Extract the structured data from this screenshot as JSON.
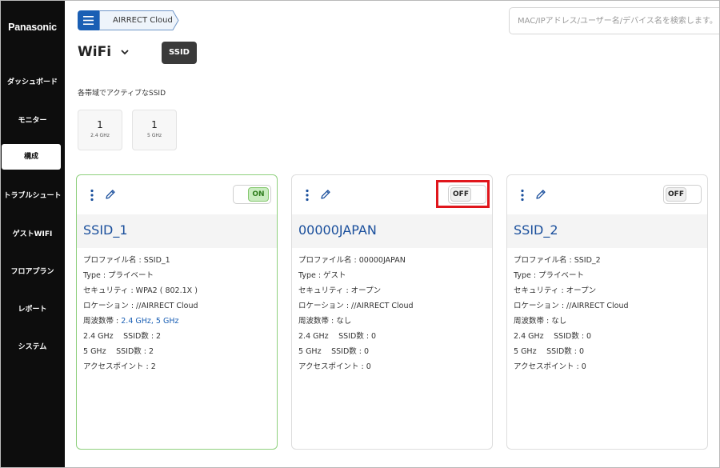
{
  "sidebar": {
    "brand": "Panasonic",
    "items": [
      {
        "label": "ダッシュボード"
      },
      {
        "label": "モニター"
      },
      {
        "label": "構成"
      },
      {
        "label": "トラブルシュート"
      },
      {
        "label": "ゲストWIFI"
      },
      {
        "label": "フロアプラン"
      },
      {
        "label": "レポート"
      },
      {
        "label": "システム"
      }
    ],
    "active_item": "構成"
  },
  "header": {
    "breadcrumb": "AIRRECT Cloud",
    "search_placeholder": "MAC/IPアドレス/ユーザー名/デバイス名を検索します。",
    "page_title": "WiFi",
    "badge": "SSID"
  },
  "bands": {
    "caption": "各帯域でアクティブなSSID",
    "items": [
      {
        "count": "1",
        "label": "2.4 GHz"
      },
      {
        "count": "1",
        "label": "5 GHz"
      }
    ]
  },
  "cards": [
    {
      "toggle": "ON",
      "name": "SSID_1",
      "profile": "プロファイル名 : SSID_1",
      "type": "Type : プライベート",
      "security": "セキュリティ : WPA2 ( 802.1X )",
      "location": "ロケーション : //AIRRECT Cloud",
      "freq_label": "周波数帯 : ",
      "freq_value": "2.4 GHz, 5 GHz",
      "ssid_24": "2.4 GHz　 SSID数 : 2",
      "ssid_5": "5 GHz　 SSID数 : 2",
      "ap": "アクセスポイント : 2"
    },
    {
      "toggle": "OFF",
      "name": "00000JAPAN",
      "profile": "プロファイル名 : 00000JAPAN",
      "type": "Type : ゲスト",
      "security": "セキュリティ : オープン",
      "location": "ロケーション : //AIRRECT Cloud",
      "freq_label": "周波数帯 : なし",
      "freq_value": "",
      "ssid_24": "2.4 GHz　 SSID数 : 0",
      "ssid_5": "5 GHz　 SSID数 : 0",
      "ap": "アクセスポイント : 0"
    },
    {
      "toggle": "OFF",
      "name": "SSID_2",
      "profile": "プロファイル名 : SSID_2",
      "type": "Type : プライベート",
      "security": "セキュリティ : オープン",
      "location": "ロケーション : //AIRRECT Cloud",
      "freq_label": "周波数帯 : なし",
      "freq_value": "",
      "ssid_24": "2.4 GHz　 SSID数 : 0",
      "ssid_5": "5 GHz　 SSID数 : 0",
      "ap": "アクセスポイント : 0"
    }
  ],
  "colors": {
    "sidebar_bg": "#0d0d0d",
    "accent_blue": "#1a5fb4",
    "on_green": "#86c76f",
    "highlight_red": "#e0161c"
  }
}
